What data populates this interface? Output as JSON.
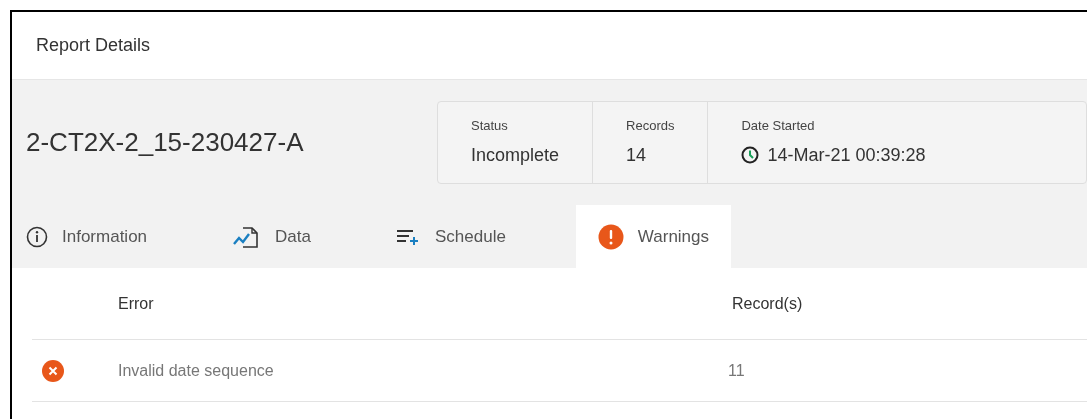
{
  "panel": {
    "title": "Report Details"
  },
  "report": {
    "name": "2-CT2X-2_15-230427-A"
  },
  "stats": [
    {
      "label": "Status",
      "value": "Incomplete",
      "kind": "text"
    },
    {
      "label": "Records",
      "value": "14",
      "kind": "text"
    },
    {
      "label": "Date Started",
      "value": "14-Mar-21 00:39:28",
      "kind": "time"
    }
  ],
  "tabs": [
    {
      "label": "Information",
      "kind": "info",
      "selected": false
    },
    {
      "label": "Data",
      "kind": "data",
      "selected": false
    },
    {
      "label": "Schedule",
      "kind": "schedule",
      "selected": false
    },
    {
      "label": "Warnings",
      "kind": "warning",
      "selected": true
    }
  ],
  "table": {
    "columns": [
      "Error",
      "Record(s)"
    ],
    "rows": [
      {
        "error": "Invalid date sequence",
        "records": "11"
      }
    ]
  }
}
